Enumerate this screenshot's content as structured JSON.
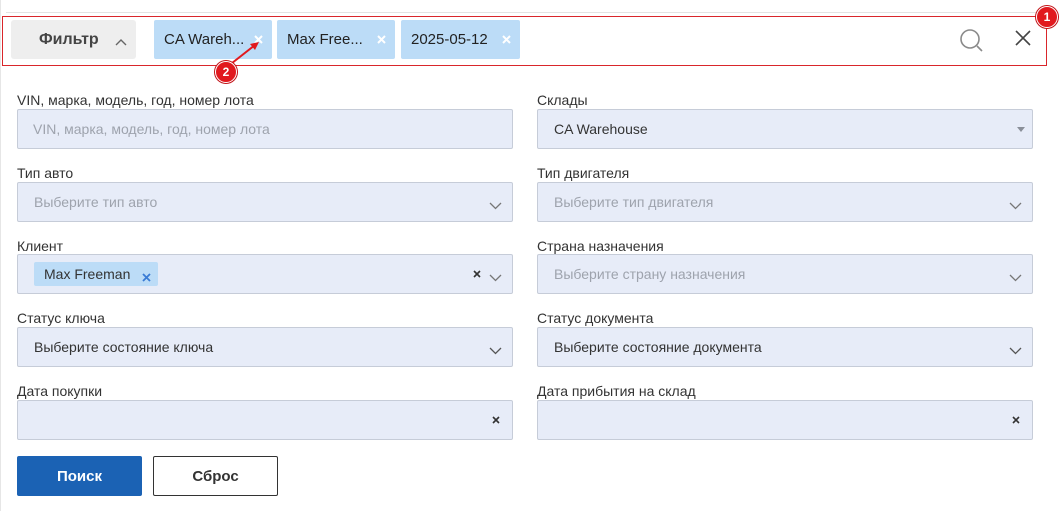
{
  "filter_bar": {
    "toggle_label": "Фильтр",
    "chips": [
      {
        "label": "CA Wareh..."
      },
      {
        "label": "Max Free..."
      },
      {
        "label": "2025-05-12"
      }
    ]
  },
  "annotations": {
    "badge_1": "1",
    "badge_2": "2",
    "color": "#e1191e"
  },
  "form": {
    "vin": {
      "label": "VIN, марка, модель, год, номер лота",
      "placeholder": "VIN, марка, модель, год, номер лота",
      "value": ""
    },
    "warehouse": {
      "label": "Склады",
      "value": "CA Warehouse"
    },
    "car_type": {
      "label": "Тип авто",
      "placeholder": "Выберите тип авто"
    },
    "engine_type": {
      "label": "Тип двигателя",
      "placeholder": "Выберите тип двигателя"
    },
    "client": {
      "label": "Клиент",
      "chip": "Max Freeman"
    },
    "destination_country": {
      "label": "Страна назначения",
      "placeholder": "Выберите страну назначения"
    },
    "key_status": {
      "label": "Статус ключа",
      "value": "Выберите состояние ключа"
    },
    "document_status": {
      "label": "Статус документа",
      "value": "Выберите состояние документа"
    },
    "purchase_date": {
      "label": "Дата покупки",
      "value": ""
    },
    "warehouse_arrival_date": {
      "label": "Дата прибытия на склад",
      "value": ""
    }
  },
  "buttons": {
    "search": "Поиск",
    "reset": "Сброс"
  },
  "colors": {
    "chip_bg": "#bcdcf7",
    "field_bg": "#e7ecf8",
    "primary": "#1b62b4",
    "highlight_border": "#d9262b"
  }
}
